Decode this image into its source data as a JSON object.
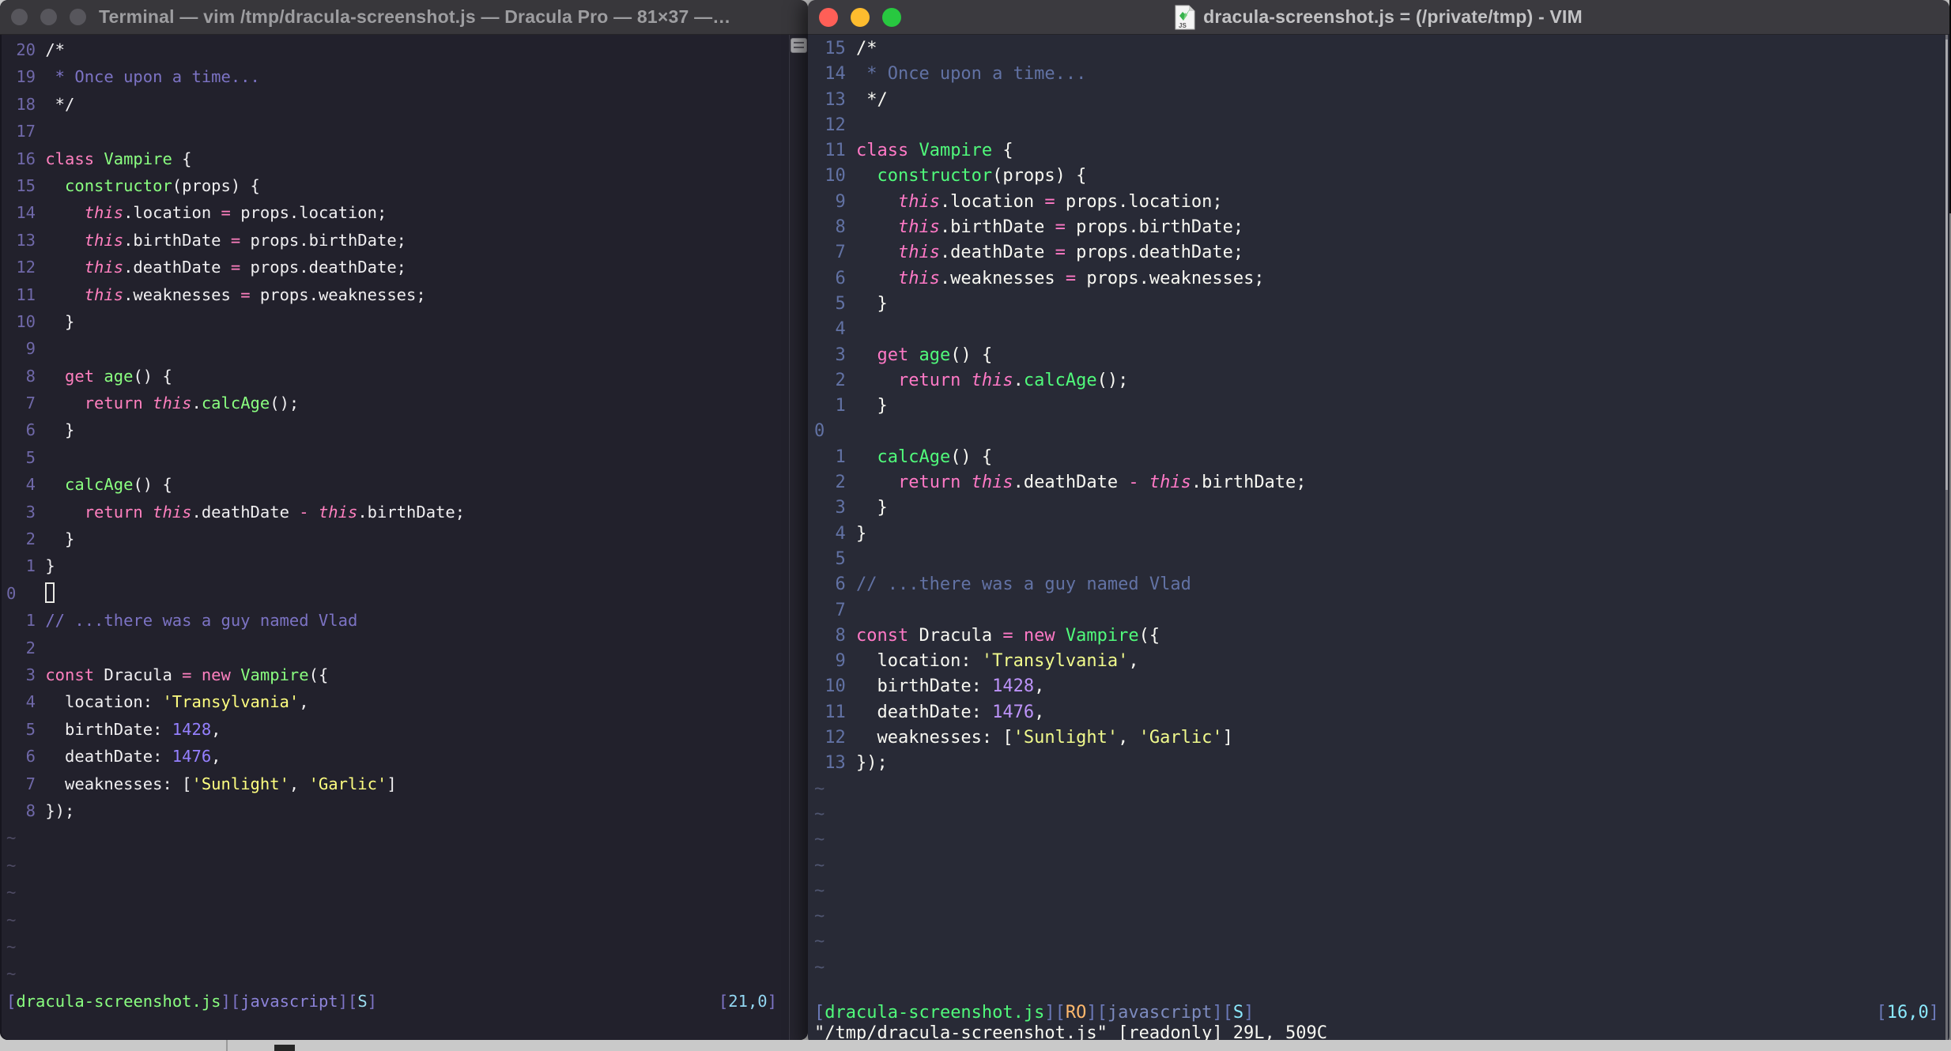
{
  "code_lines": [
    [
      [
        "d",
        "/*"
      ]
    ],
    [
      [
        "c",
        " * Once upon a time..."
      ]
    ],
    [
      [
        "d",
        " */"
      ]
    ],
    [],
    [
      [
        "k",
        "class "
      ],
      [
        "f",
        "Vampire"
      ],
      [
        "d",
        " {"
      ]
    ],
    [
      [
        "d",
        "  "
      ],
      [
        "f",
        "constructor"
      ],
      [
        "d",
        "(props) {"
      ]
    ],
    [
      [
        "d",
        "    "
      ],
      [
        "t",
        "this"
      ],
      [
        "d",
        ".location "
      ],
      [
        "k",
        "="
      ],
      [
        "d",
        " props.location;"
      ]
    ],
    [
      [
        "d",
        "    "
      ],
      [
        "t",
        "this"
      ],
      [
        "d",
        ".birthDate "
      ],
      [
        "k",
        "="
      ],
      [
        "d",
        " props.birthDate;"
      ]
    ],
    [
      [
        "d",
        "    "
      ],
      [
        "t",
        "this"
      ],
      [
        "d",
        ".deathDate "
      ],
      [
        "k",
        "="
      ],
      [
        "d",
        " props.deathDate;"
      ]
    ],
    [
      [
        "d",
        "    "
      ],
      [
        "t",
        "this"
      ],
      [
        "d",
        ".weaknesses "
      ],
      [
        "k",
        "="
      ],
      [
        "d",
        " props.weaknesses;"
      ]
    ],
    [
      [
        "d",
        "  }"
      ]
    ],
    [],
    [
      [
        "d",
        "  "
      ],
      [
        "k",
        "get "
      ],
      [
        "f",
        "age"
      ],
      [
        "d",
        "() {"
      ]
    ],
    [
      [
        "d",
        "    "
      ],
      [
        "k",
        "return "
      ],
      [
        "t",
        "this"
      ],
      [
        "d",
        "."
      ],
      [
        "f",
        "calcAge"
      ],
      [
        "d",
        "();"
      ]
    ],
    [
      [
        "d",
        "  }"
      ]
    ],
    [],
    [
      [
        "d",
        "  "
      ],
      [
        "f",
        "calcAge"
      ],
      [
        "d",
        "() {"
      ]
    ],
    [
      [
        "d",
        "    "
      ],
      [
        "k",
        "return "
      ],
      [
        "t",
        "this"
      ],
      [
        "d",
        ".deathDate "
      ],
      [
        "k",
        "-"
      ],
      [
        "d",
        " "
      ],
      [
        "t",
        "this"
      ],
      [
        "d",
        ".birthDate;"
      ]
    ],
    [
      [
        "d",
        "  }"
      ]
    ],
    [
      [
        "d",
        "}"
      ]
    ],
    [],
    [
      [
        "c",
        "// ...there was a guy named Vlad"
      ]
    ],
    [],
    [
      [
        "k",
        "const"
      ],
      [
        "d",
        " Dracula "
      ],
      [
        "k",
        "="
      ],
      [
        "d",
        " "
      ],
      [
        "k",
        "new"
      ],
      [
        "d",
        " "
      ],
      [
        "f",
        "Vampire"
      ],
      [
        "d",
        "({"
      ]
    ],
    [
      [
        "d",
        "  location: "
      ],
      [
        "s",
        "'Transylvania'"
      ],
      [
        "d",
        ","
      ]
    ],
    [
      [
        "d",
        "  birthDate: "
      ],
      [
        "n",
        "1428"
      ],
      [
        "d",
        ","
      ]
    ],
    [
      [
        "d",
        "  deathDate: "
      ],
      [
        "n",
        "1476"
      ],
      [
        "d",
        ","
      ]
    ],
    [
      [
        "d",
        "  weaknesses: ["
      ],
      [
        "s",
        "'Sunlight'"
      ],
      [
        "d",
        ", "
      ],
      [
        "s",
        "'Garlic'"
      ],
      [
        "d",
        "]"
      ]
    ],
    [
      [
        "d",
        "});"
      ]
    ]
  ],
  "left_window": {
    "title": "Terminal — vim /tmp/dracula-screenshot.js — Dracula Pro — 81×37 —…",
    "theme_name": "Dracula Pro",
    "cursor_line": 21,
    "cursor_style": "hollow",
    "tildes": 6,
    "statusline": [
      [
        "br",
        "["
      ],
      [
        "fn",
        "dracula-screenshot.js"
      ],
      [
        "br",
        "]["
      ],
      [
        "ft",
        "javascript"
      ],
      [
        "br",
        "]["
      ],
      [
        "fl",
        "S"
      ],
      [
        "br",
        "]"
      ]
    ],
    "ruler": [
      [
        "br",
        "["
      ],
      [
        "ps",
        "21,0"
      ],
      [
        "br",
        "]"
      ]
    ]
  },
  "right_window": {
    "title": "dracula-screenshot.js = (/private/tmp) - VIM",
    "file_icon_label": "JS",
    "cursor_line": 16,
    "cursor_style": "none",
    "tildes": 8,
    "statusline": [
      [
        "br",
        "["
      ],
      [
        "fn",
        "dracula-screenshot.js"
      ],
      [
        "br",
        "]["
      ],
      [
        "ro",
        "RO"
      ],
      [
        "br",
        "]["
      ],
      [
        "ft",
        "javascript"
      ],
      [
        "br",
        "]["
      ],
      [
        "fl",
        "S"
      ],
      [
        "br",
        "]"
      ]
    ],
    "ruler": [
      [
        "br",
        "["
      ],
      [
        "ps",
        "16,0"
      ],
      [
        "br",
        "]"
      ]
    ],
    "cmdline": "\"/tmp/dracula-screenshot.js\" [readonly] 29L, 509C"
  },
  "colors": {
    "left_bg": "#22212C",
    "right_bg": "#282A36",
    "left_pink": "#FF80BF",
    "left_green": "#8AFF80",
    "left_yellow": "#FFFF80",
    "left_purple": "#9580FF",
    "left_comment": "#7C73C4",
    "right_pink": "#FF79C6",
    "right_green": "#50FA7B",
    "right_yellow": "#F1FA8C",
    "right_purple": "#BD93F9",
    "right_comment": "#6272A4",
    "traffic_red": "#FF5F57",
    "traffic_yellow": "#FEBC2E",
    "traffic_green": "#28C840",
    "inactive_light": "#57565C"
  }
}
